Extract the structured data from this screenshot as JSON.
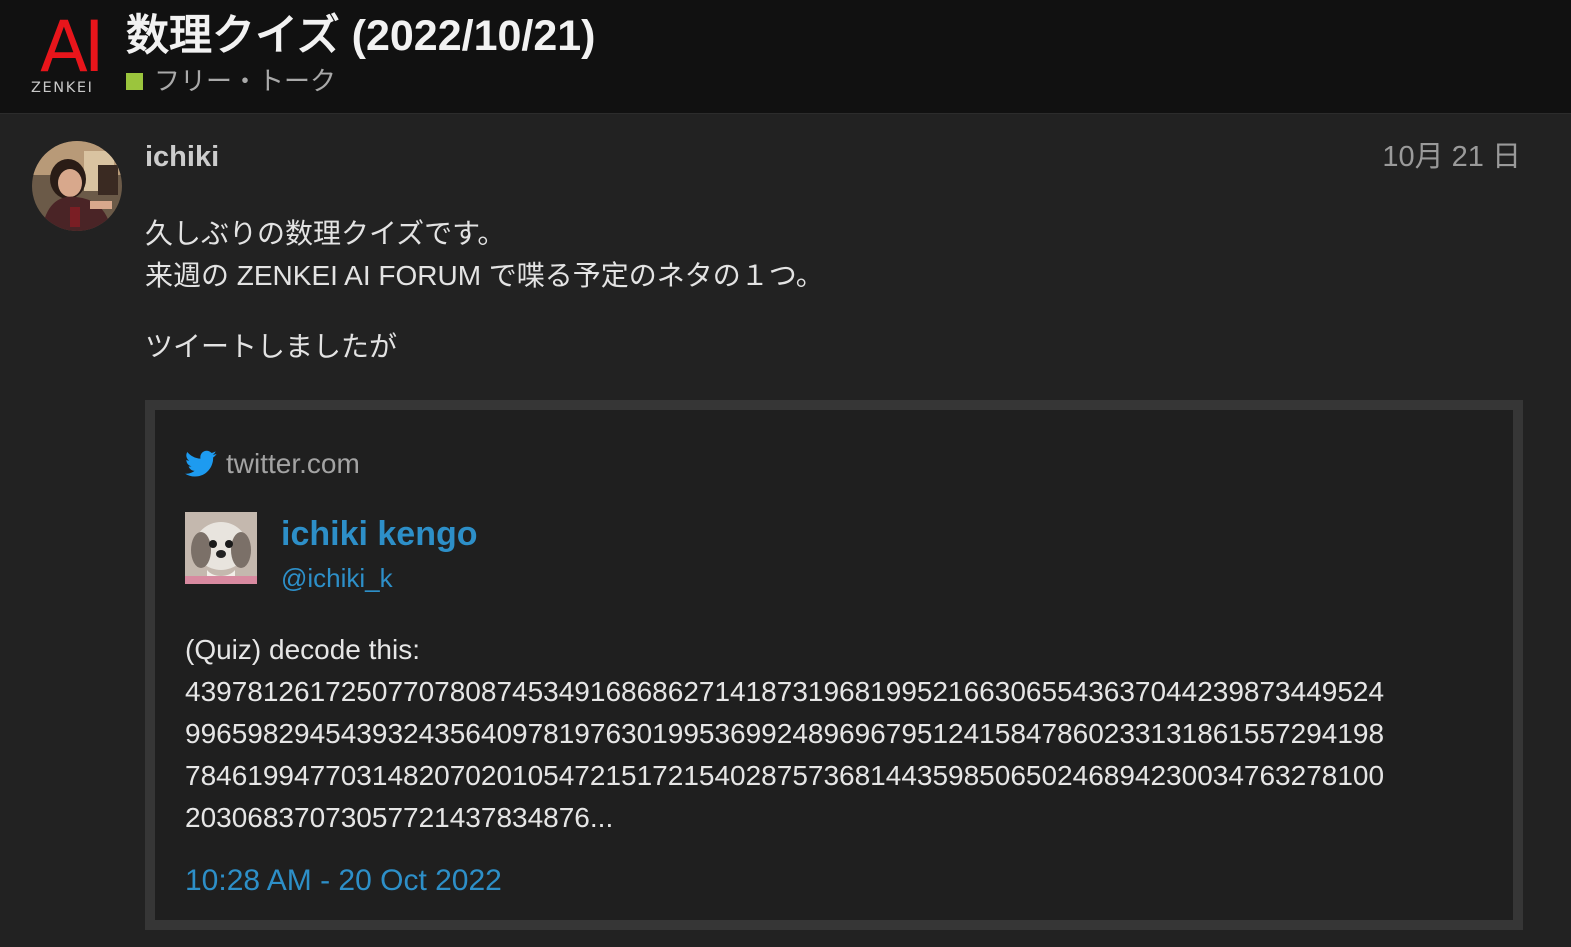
{
  "header": {
    "logo": {
      "mark": "AI",
      "wordmark": "ZENKEI"
    },
    "title": "数理クイズ (2022/10/21)",
    "category": {
      "name": "フリー・トーク",
      "color": "#9bc53d"
    }
  },
  "post": {
    "author": "ichiki",
    "date": "10月 21 日",
    "avatar_icon": "user-photo-avatar",
    "paragraphs": [
      "久しぶりの数理クイズです。",
      "来週の ZENKEI AI FORUM で喋る予定のネタの１つ。",
      "ツイートしましたが"
    ]
  },
  "onebox": {
    "source": "twitter.com",
    "source_icon": "twitter-bird-icon",
    "accent_color": "#2d8fc8",
    "tweet": {
      "display_name": "ichiki kengo",
      "handle": "@ichiki_k",
      "avatar_icon": "dog-photo-avatar",
      "text_lines": [
        "(Quiz) decode this:",
        "4397812617250770780874534916868627141873196819952166306554363704423987344952​4",
        "99659829454393243564097819763019953699248969679512415847860233131861557294198",
        "78461994770314820702010547215172154028757368144359850650246894230034763278100",
        "2030683707305772143783487​6..."
      ],
      "timestamp": "10:28 AM - 20 Oct 2022"
    }
  }
}
